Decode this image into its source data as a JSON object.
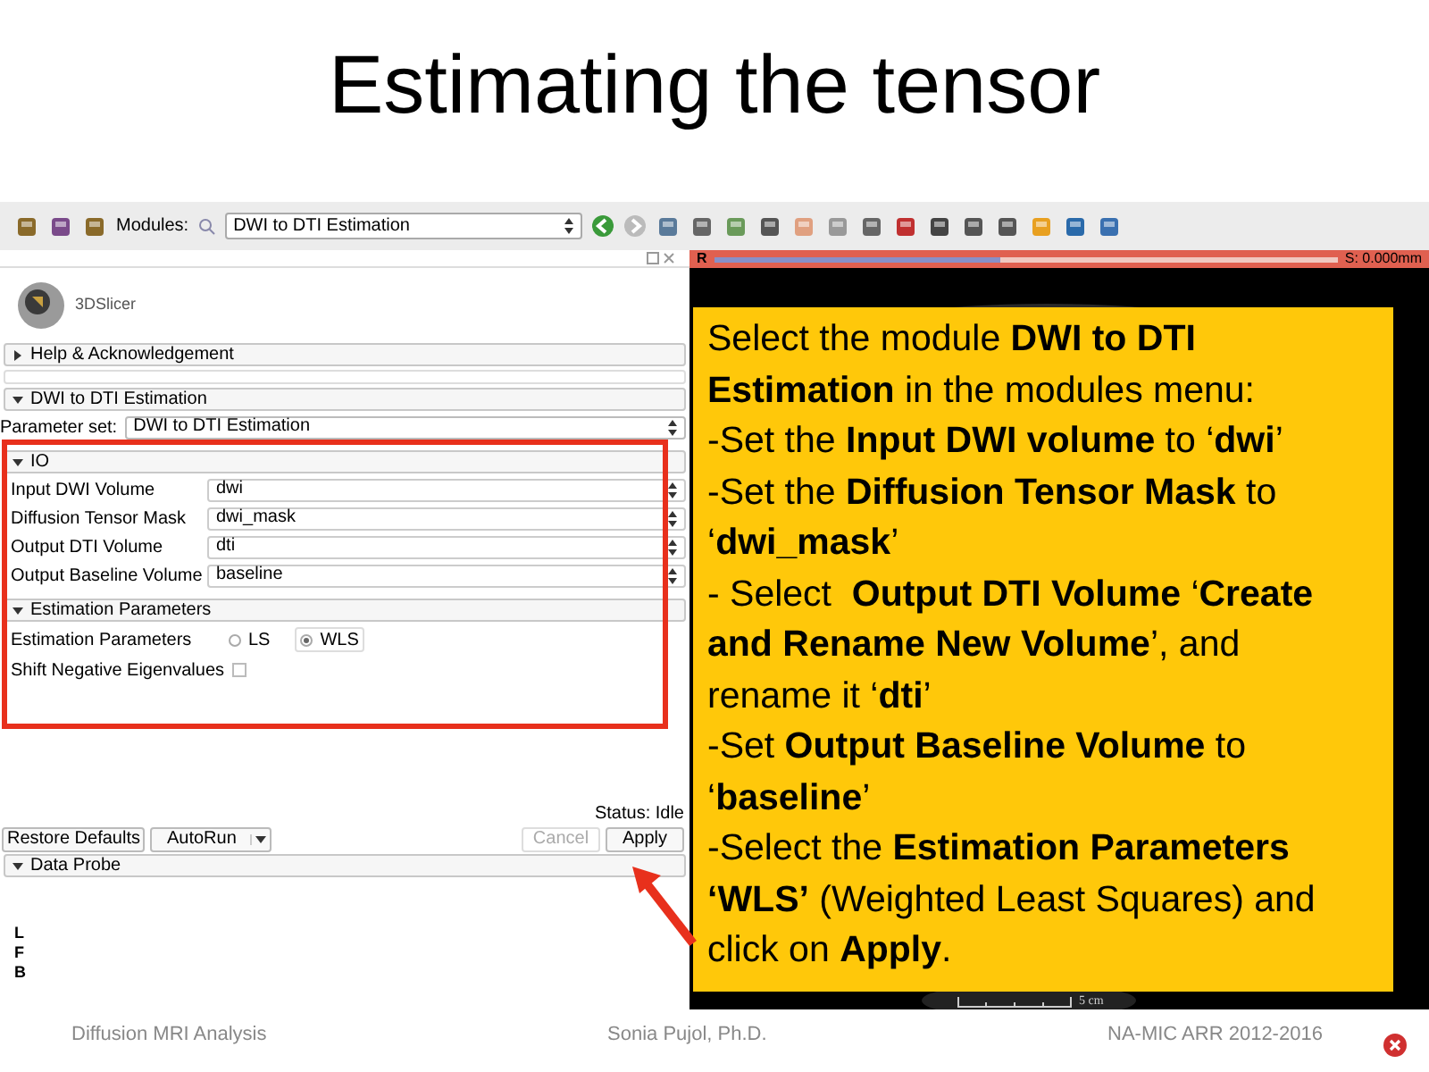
{
  "slide_title": "Estimating the tensor",
  "toolbar": {
    "modules_label": "Modules:",
    "module_select": "DWI to DTI Estimation"
  },
  "slice_bar": {
    "label": "R",
    "reading": "S: 0.000mm",
    "level": 0.46
  },
  "logo_text": "3DSlicer",
  "sections": [
    {
      "title": "Help & Acknowledgement",
      "expanded": false
    },
    {
      "title": "DWI to DTI Estimation",
      "expanded": true
    }
  ],
  "parameter_set": {
    "label": "Parameter set:",
    "value": "DWI to DTI Estimation"
  },
  "io": {
    "title": "IO",
    "expanded": true,
    "fields": [
      {
        "label": "Input DWI Volume",
        "value": "dwi"
      },
      {
        "label": "Diffusion Tensor Mask",
        "value": "dwi_mask"
      },
      {
        "label": "Output DTI Volume",
        "value": "dti"
      },
      {
        "label": "Output Baseline Volume",
        "value": "baseline"
      }
    ]
  },
  "estimation": {
    "title": "Estimation Parameters",
    "expanded": true,
    "label": "Estimation Parameters",
    "options": [
      {
        "label": "LS",
        "selected": false
      },
      {
        "label": "WLS",
        "selected": true
      }
    ],
    "shift": {
      "label": "Shift Negative Eigenvalues",
      "checked": false
    }
  },
  "status": "Status: Idle",
  "buttons": {
    "restore": "Restore Defaults",
    "autorun": "AutoRun",
    "cancel": {
      "label": "Cancel",
      "disabled": true
    },
    "apply": {
      "label": "Apply",
      "disabled": false
    }
  },
  "data_probe": {
    "title": "Data Probe",
    "expanded": true
  },
  "orientation_labels": [
    "L",
    "F",
    "B"
  ],
  "callout": {
    "paragraphs": [
      "Select the module **DWI to DTI Estimation** in the modules menu:",
      "-Set the **Input DWI volume** to ‘**dwi**’",
      "-Set the **Diffusion Tensor Mask** to ‘**dwi_mask**’",
      "- Select  **Output DTI Volume** ‘**Create and Rename New Volume**’, and rename it ‘**dti**’",
      "-Set **Output Baseline Volume** to ‘**baseline**’",
      "-Select the **Estimation Parameters ‘WLS’** (Weighted Least Squares) and click on **Apply**."
    ]
  },
  "scale_label": "5 cm",
  "footer": [
    "Diffusion MRI Analysis",
    "Sonia Pujol, Ph.D.",
    "NA-MIC ARR 2012-2016"
  ]
}
